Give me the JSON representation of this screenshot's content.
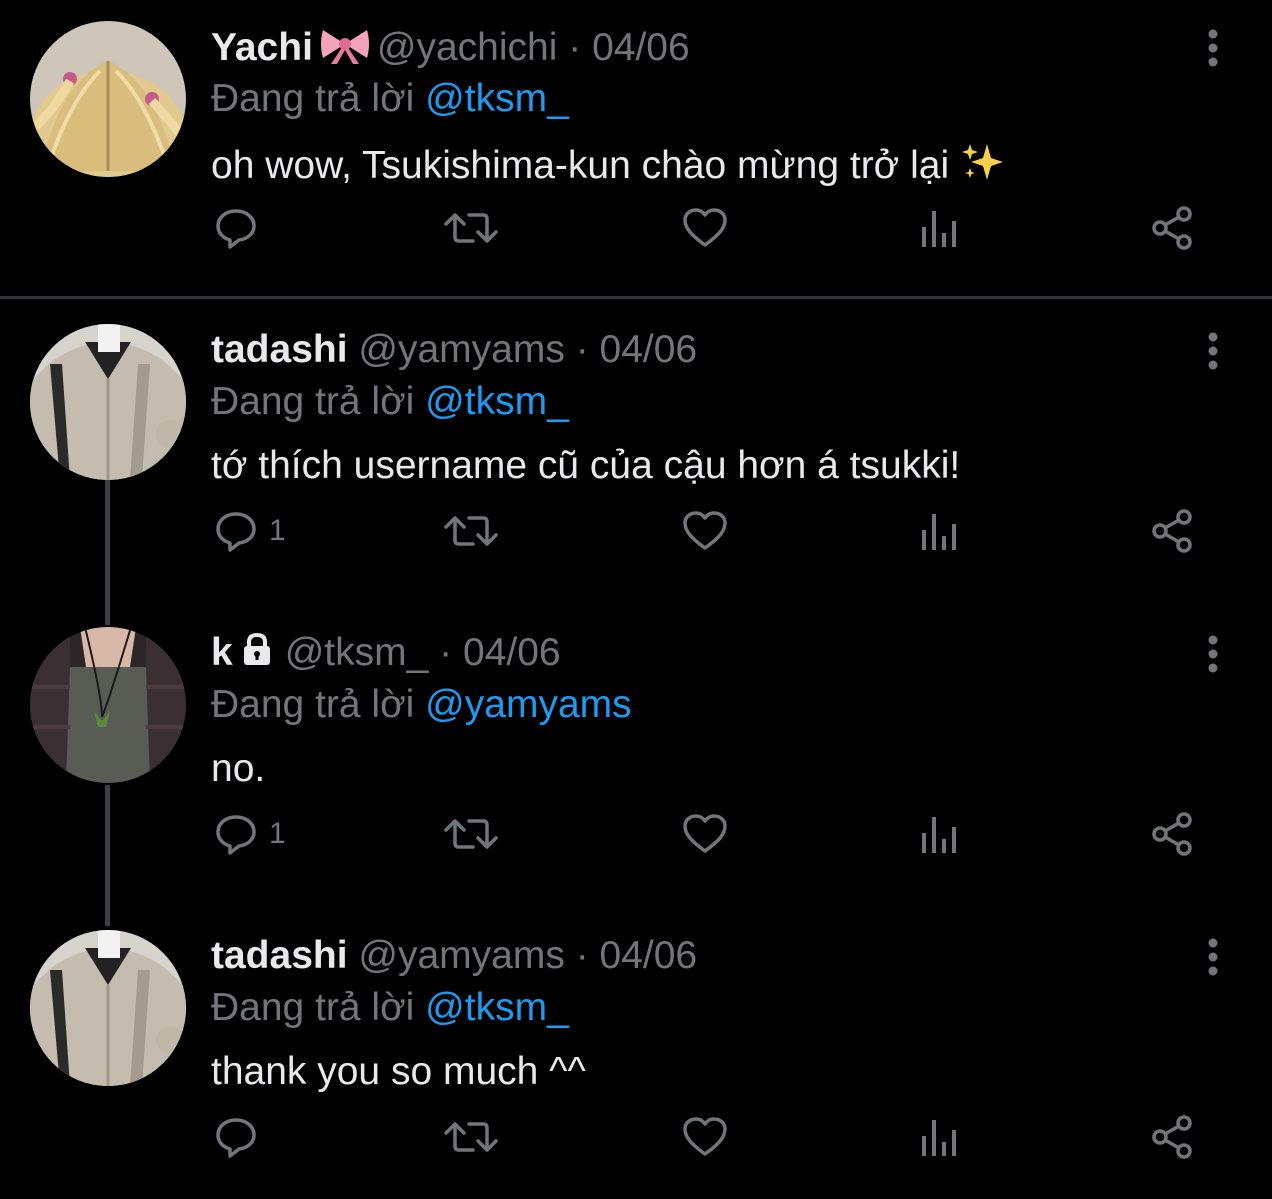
{
  "tweets": [
    {
      "name": "Yachi",
      "name_emoji": "ribbon-emoji",
      "handle": "@yachichi",
      "separator": "·",
      "date": "04/06",
      "reply_prefix": "Đang trả lời",
      "reply_to": "@tksm_",
      "text": "oh wow, Tsukishima-kun chào mừng trở lại",
      "text_emoji": "sparkles-emoji",
      "reply_count": "",
      "locked": false
    },
    {
      "name": "tadashi",
      "handle": "@yamyams",
      "separator": "·",
      "date": "04/06",
      "reply_prefix": "Đang trả lời",
      "reply_to": "@tksm_",
      "text": "tớ thích username cũ của cậu hơn á tsukki!",
      "reply_count": "1",
      "locked": false
    },
    {
      "name": "k",
      "handle": "@tksm_",
      "separator": "·",
      "date": "04/06",
      "reply_prefix": "Đang trả lời",
      "reply_to": "@yamyams",
      "text": "no.",
      "reply_count": "1",
      "locked": true
    },
    {
      "name": "tadashi",
      "handle": "@yamyams",
      "separator": "·",
      "date": "04/06",
      "reply_prefix": "Đang trả lời",
      "reply_to": "@tksm_",
      "text": "thank you so much ^^",
      "reply_count": "",
      "locked": false
    }
  ],
  "icons": [
    "reply-icon",
    "retweet-icon",
    "like-icon",
    "views-icon",
    "share-icon",
    "more-icon",
    "lock-icon"
  ],
  "colors": {
    "background": "#000000",
    "text_primary": "#e7e9ea",
    "text_secondary": "#71767b",
    "mention": "#1d9bf0",
    "thread_line": "#3b4047",
    "divider": "#2f3336"
  }
}
